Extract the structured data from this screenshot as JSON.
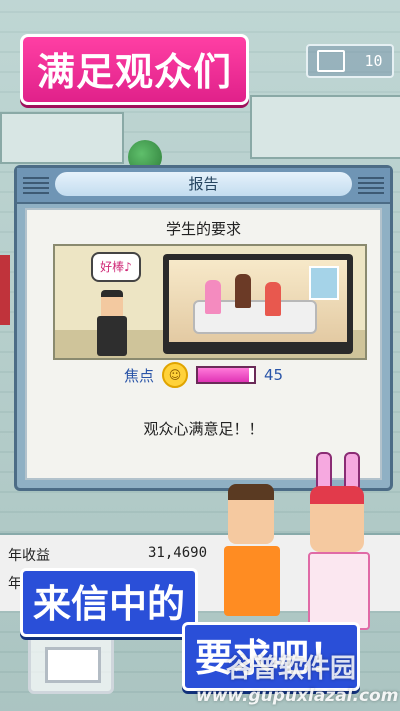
{
  "promo": {
    "top_title": "满足观众们",
    "bottom_line1": "来信中的",
    "bottom_line2": "要求吧！"
  },
  "hud": {
    "icon": "monitor-icon",
    "value": "10"
  },
  "report_dialog": {
    "title": "报告",
    "subtitle": "学生的要求",
    "speech_bubble": "好棒♪",
    "focus_label": "焦点",
    "focus_icon": "smiley-icon",
    "focus_value": "45",
    "message": "观众心满意足！！"
  },
  "stats": {
    "row1_label": "年收益",
    "row1_value": "31,4690",
    "row2_label": "年"
  },
  "watermark": {
    "name": "谷普软件园",
    "url": "www.gupuxlazal.com"
  },
  "colors": {
    "pink_banner": "#e0218a",
    "blue_banner": "#2a4fd8",
    "dialog_frame": "#6f95b5",
    "focus_text": "#2a55a8"
  }
}
